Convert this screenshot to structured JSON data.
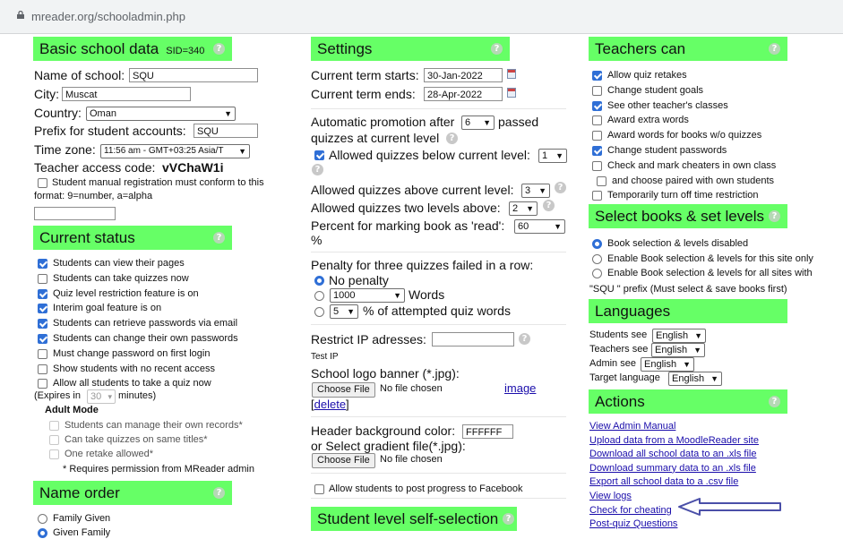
{
  "browser": {
    "url": "mreader.org/schooladmin.php"
  },
  "basic": {
    "title": "Basic school data",
    "sid": "SID=340",
    "name_label": "Name of school:",
    "name_value": "SQU",
    "city_label": "City:",
    "city_value": "Muscat",
    "country_label": "Country:",
    "country_value": "Oman",
    "prefix_label": "Prefix for student accounts:",
    "prefix_value": "SQU",
    "tz_label": "Time zone:",
    "tz_value": "11:56 am - GMT+03:25 Asia/T",
    "code_label": "Teacher access code:",
    "code_value": "vVChaW1i",
    "manual_reg_1": "Student manual registration must conform to this",
    "manual_reg_2": "format: 9=number, a=alpha"
  },
  "status": {
    "title": "Current status",
    "items": [
      {
        "label": "Students can view their pages",
        "checked": true
      },
      {
        "label": "Students can take quizzes now",
        "checked": false
      },
      {
        "label": "Quiz level restriction feature is on",
        "checked": true
      },
      {
        "label": "Interim goal feature is on",
        "checked": true
      },
      {
        "label": "Students can retrieve passwords via email",
        "checked": true
      },
      {
        "label": "Students can change their own passwords",
        "checked": true
      },
      {
        "label": "Must change password on first login",
        "checked": false
      },
      {
        "label": "Show students with no recent access",
        "checked": false
      },
      {
        "label": "Allow all students to take a quiz now",
        "checked": false
      }
    ],
    "expires_prefix": "(Expires in",
    "expires_value": "30",
    "expires_suffix": "minutes)",
    "adult_mode": "Adult Mode",
    "adult_items": [
      "Students can manage their own records*",
      "Can take quizzes on same titles*",
      "One retake allowed*"
    ],
    "requires_note": "* Requires permission from MReader admin"
  },
  "name_order": {
    "title": "Name order",
    "options": [
      "Family Given",
      "Given Family"
    ],
    "selected": 1
  },
  "settings": {
    "title": "Settings",
    "term_start_label": "Current term starts:",
    "term_start_value": "30-Jan-2022",
    "term_end_label": "Current term ends:",
    "term_end_value": "28-Apr-2022",
    "promo_pre": "Automatic promotion after",
    "promo_value": "6",
    "promo_post": "passed",
    "promo_line2": "quizzes at current level",
    "below_label": "Allowed quizzes below current level:",
    "below_value": "1",
    "above_label": "Allowed quizzes above current level:",
    "above_value": "3",
    "two_above_label": "Allowed quizzes two levels above:",
    "two_above_value": "2",
    "percent_label": "Percent for marking book as 'read':",
    "percent_value": "60",
    "percent_unit": "%",
    "penalty_label": "Penalty for three quizzes failed in a row:",
    "penalty_none": "No penalty",
    "penalty_words_value": "1000",
    "penalty_words_unit": "Words",
    "penalty_pct_value": "5",
    "penalty_pct_unit": "% of attempted quiz words",
    "restrict_ip_label": "Restrict IP adresses:",
    "test_ip": "Test IP",
    "logo_label": "School logo banner (*.jpg):",
    "choose_file": "Choose File",
    "no_file": "No file chosen",
    "image_link": "image",
    "delete_link": "delete",
    "bgcolor_label": "Header background color:",
    "bgcolor_value": "FFFFFF",
    "gradient_label": "or Select gradient file(*.jpg):",
    "facebook_label": "Allow students to post progress to Facebook"
  },
  "self_selection": {
    "title": "Student level self-selection"
  },
  "teachers": {
    "title": "Teachers can",
    "items": [
      {
        "label": "Allow quiz retakes",
        "checked": true
      },
      {
        "label": "Change student goals",
        "checked": false
      },
      {
        "label": "See other teacher's classes",
        "checked": true
      },
      {
        "label": "Award extra words",
        "checked": false
      },
      {
        "label": "Award words for books w/o quizzes",
        "checked": false
      },
      {
        "label": "Change student passwords",
        "checked": true
      },
      {
        "label": "Check and mark cheaters in own class",
        "checked": false
      },
      {
        "label": "and choose paired with own students",
        "checked": false
      },
      {
        "label": "Temporarily turn off time restriction",
        "checked": false
      }
    ]
  },
  "books": {
    "title": "Select books & set levels",
    "options": [
      "Book selection & levels disabled",
      "Enable Book selection & levels for this site only",
      "Enable Book selection & levels for all sites with"
    ],
    "note": "\"SQU \" prefix (Must select & save books first)",
    "selected": 0
  },
  "languages": {
    "title": "Languages",
    "rows": [
      {
        "label": "Students see",
        "value": "English"
      },
      {
        "label": "Teachers see",
        "value": "English"
      },
      {
        "label": "Admin see",
        "value": "English"
      },
      {
        "label": "Target language",
        "value": "English"
      }
    ]
  },
  "actions": {
    "title": "Actions",
    "links": [
      "View Admin Manual",
      "Upload data from a MoodleReader site",
      "Download all school data to an .xls file",
      "Download summary data to an .xls file",
      "Export all school data to a .csv file",
      "View logs",
      "Check for cheating",
      "Post-quiz Questions"
    ]
  },
  "colors": {
    "header_green": "#66ff66",
    "link": "#1a0dab",
    "checkbox_blue": "#2f6fd6",
    "arrow": "#4a4fa8"
  }
}
